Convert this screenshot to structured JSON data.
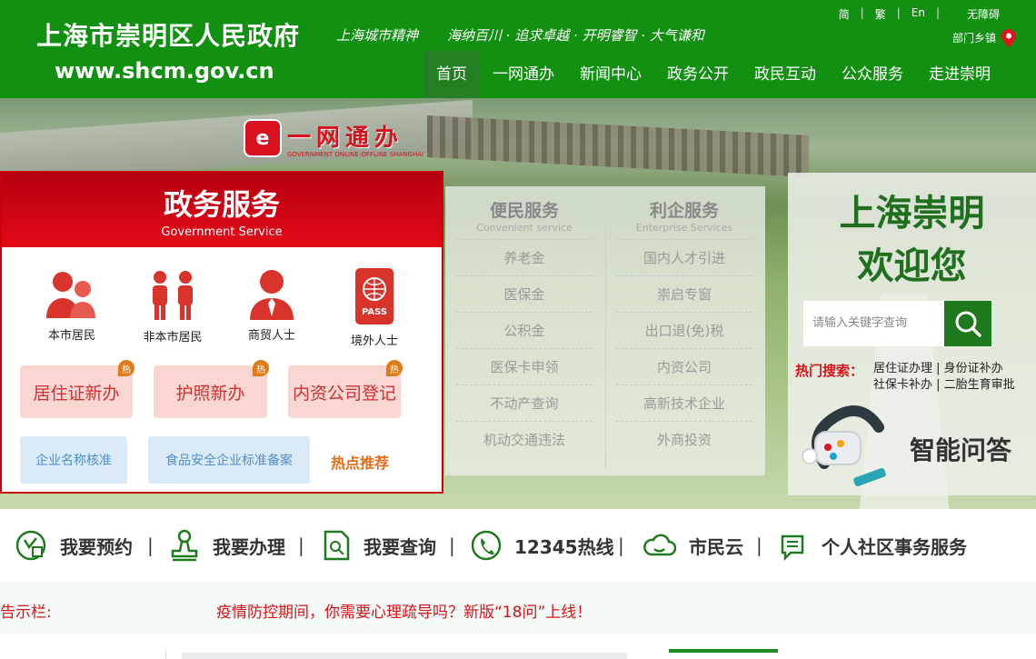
{
  "header": {
    "title": "上海市崇明区人民政府",
    "url": "www.shcm.gov.cn",
    "slogan_left": "上海城市精神",
    "slogan_right": "海纳百川 · 追求卓越 · 开明睿智 · 大气谦和",
    "lang": [
      "简",
      "繁",
      "En"
    ],
    "accessibility": "无障碍",
    "dept": "部门乡镇",
    "nav": [
      "首页",
      "一网通办",
      "新闻中心",
      "政务公开",
      "政民互动",
      "公众服务",
      "走进崇明"
    ]
  },
  "ywtb": {
    "cn": "一网通办",
    "en": "GOVERNMENT ONLINE-OFFLINE SHANGHAI"
  },
  "gov": {
    "title": "政务服务",
    "subtitle": "Government Service",
    "categories": [
      "本市居民",
      "非本市居民",
      "商贸人士",
      "境外人士"
    ],
    "hot_badge": "热",
    "pink_buttons": [
      "居住证新办",
      "护照新办",
      "内资公司登记"
    ],
    "blue_buttons": [
      "企业名称核准",
      "食品安全企业标准备案"
    ],
    "hot_link": "热点推荐"
  },
  "services": {
    "left": {
      "title": "便民服务",
      "sub": "Convenient service",
      "items": [
        "养老金",
        "医保金",
        "公积金",
        "医保卡申领",
        "不动产查询",
        "机动交通违法"
      ]
    },
    "right": {
      "title": "利企服务",
      "sub": "Enterprise Services",
      "items": [
        "国内人才引进",
        "崇启专窗",
        "出口退(免)税",
        "内资公司",
        "高新技术企业",
        "外商投资"
      ]
    }
  },
  "welcome": {
    "line1": "上海崇明",
    "line2": "欢迎您",
    "search_placeholder": "请输入关键字查询",
    "hot_label": "热门搜索：",
    "hot_line1": "居住证办理 | 身份证补办",
    "hot_line2": "社保卡补办 | 二胎生育审批",
    "qa": "智能问答"
  },
  "quick": [
    "我要预约",
    "我要办理",
    "我要查询",
    "12345热线",
    "市民云",
    "个人社区事务服务"
  ],
  "notice": {
    "label": "告示栏:",
    "text": "疫情防控期间，你需要心理疏导吗？新版“18问”上线！"
  },
  "colors": {
    "green": "#129012",
    "red": "#d8111d",
    "orange": "#e76b16"
  }
}
